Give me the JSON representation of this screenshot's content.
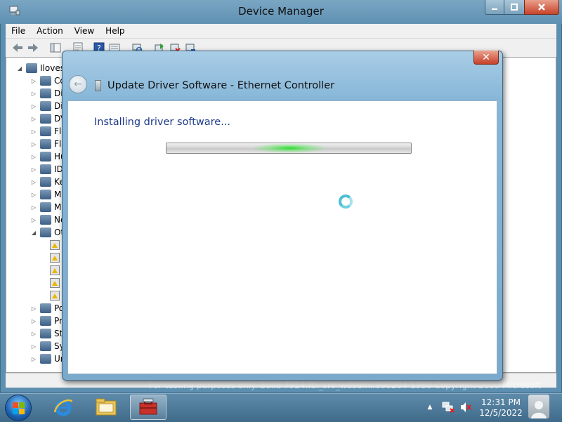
{
  "main_window": {
    "title": "Device Manager",
    "caption_buttons": [
      "minimize",
      "maximize",
      "close"
    ],
    "menu": [
      "File",
      "Action",
      "View",
      "Help"
    ],
    "toolbar_icons": [
      "back-arrow-icon",
      "forward-arrow-icon",
      "properties-icon",
      "show-hide-tree-icon",
      "help-icon",
      "view-icon",
      "scan-hardware-icon",
      "update-driver-icon",
      "disable-device-icon",
      "uninstall-device-icon"
    ],
    "tree": {
      "root": "Iloves",
      "items": [
        {
          "label": "Co",
          "expander": "▷"
        },
        {
          "label": "Di",
          "expander": "▷"
        },
        {
          "label": "Dis",
          "expander": "▷"
        },
        {
          "label": "DVD",
          "expander": "▷"
        },
        {
          "label": "Flo",
          "expander": "▷"
        },
        {
          "label": "Flo",
          "expander": "▷"
        },
        {
          "label": "Hu",
          "expander": "▷"
        },
        {
          "label": "IDE",
          "expander": "▷"
        },
        {
          "label": "Key",
          "expander": "▷"
        },
        {
          "label": "Mic",
          "expander": "▷"
        },
        {
          "label": "Mo",
          "expander": "▷"
        },
        {
          "label": "Net",
          "expander": "▷"
        },
        {
          "label": "Oth",
          "expander": "◢"
        },
        {
          "label": "",
          "expander": "",
          "warning": true
        },
        {
          "label": "",
          "expander": "",
          "warning": true
        },
        {
          "label": "",
          "expander": "",
          "warning": true
        },
        {
          "label": "",
          "expander": "",
          "warning": true
        },
        {
          "label": "",
          "expander": "",
          "warning": true
        },
        {
          "label": "Por",
          "expander": "▷"
        },
        {
          "label": "Pro",
          "expander": "▷"
        },
        {
          "label": "Sto",
          "expander": "▷"
        },
        {
          "label": "Sys",
          "expander": "▷"
        },
        {
          "label": "Uni",
          "expander": "▷"
        }
      ]
    }
  },
  "dialog": {
    "title": "Update Driver Software - Ethernet Controller",
    "close_label": "✕",
    "back_label": "←",
    "heading": "Installing driver software...",
    "progress_style": "marquee"
  },
  "watermark": "For testing purposes only. Build 7924.fbl_srv_wdsdmi.090204-1950 Copyright 2009 Microsoft",
  "taskbar": {
    "apps": [
      "internet-explorer-icon",
      "windows-explorer-icon",
      "device-manager-icon"
    ],
    "tray": {
      "show_hidden_label": "▲",
      "clock_time": "12:31 PM",
      "clock_date": "12/5/2022"
    }
  },
  "colors": {
    "dialog_heading": "#1e3a8a",
    "progress_glow": "#28dc28",
    "spinner": "#49c0d2"
  }
}
